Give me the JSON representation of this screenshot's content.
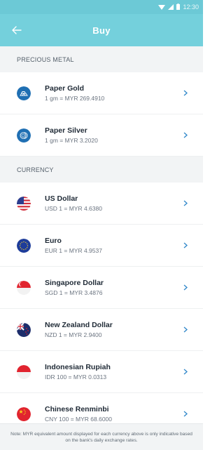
{
  "status_bar": {
    "time": "12:30"
  },
  "header": {
    "title": "Buy"
  },
  "sections": {
    "precious_metal": {
      "label": "PRECIOUS METAL",
      "items": [
        {
          "name": "Paper Gold",
          "rate": "1 gm = MYR 269.4910",
          "icon": "gold-bars-icon",
          "color": "#1f6fb3"
        },
        {
          "name": "Paper Silver",
          "rate": "1 gm = MYR 3.2020",
          "icon": "silver-coins-icon",
          "color": "#1f6fb3"
        }
      ]
    },
    "currency": {
      "label": "CURRENCY",
      "items": [
        {
          "name": "US Dollar",
          "rate": "USD 1 = MYR 4.6380",
          "icon": "us-flag-icon"
        },
        {
          "name": "Euro",
          "rate": "EUR 1 = MYR 4.9537",
          "icon": "eu-flag-icon"
        },
        {
          "name": "Singapore Dollar",
          "rate": "SGD 1 = MYR 3.4876",
          "icon": "singapore-flag-icon"
        },
        {
          "name": "New Zealand Dollar",
          "rate": "NZD 1 = MYR 2.9400",
          "icon": "new-zealand-flag-icon"
        },
        {
          "name": "Indonesian Rupiah",
          "rate": "IDR 100 = MYR 0.0313",
          "icon": "indonesia-flag-icon"
        },
        {
          "name": "Chinese Renminbi",
          "rate": "CNY 100 = MYR 68.6000",
          "icon": "china-flag-icon"
        }
      ]
    }
  },
  "footer": {
    "note": "Note: MYR equivalent amount displayed for each currency above is only indicative based on the bank's daily exchange rates."
  },
  "colors": {
    "accent": "#74d0dc",
    "status_bar": "#6cc9d6",
    "chevron": "#2e86c9"
  }
}
